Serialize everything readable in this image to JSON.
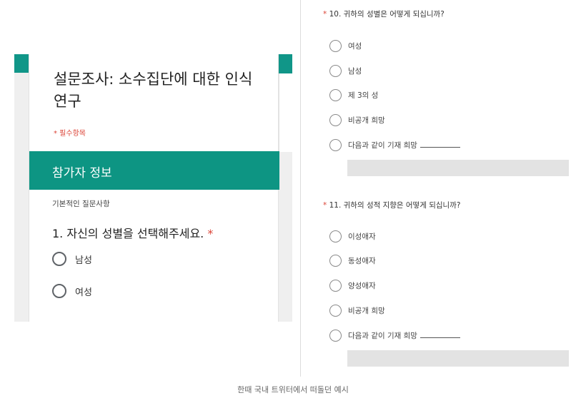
{
  "left_form": {
    "title": "설문조사: 소수집단에 대한 인식 연구",
    "required_note": "* 필수항목",
    "section_title": "참가자 정보",
    "section_description": "기본적인 질문사항",
    "question_text": "1. 자신의 성별을 선택해주세요.",
    "question_required_mark": "*",
    "options": [
      "남성",
      "여성"
    ],
    "accent_color": "#0d9583"
  },
  "right_form": {
    "q10": {
      "required_mark": "*",
      "title": "10. 귀하의 성별은 어떻게 되십니까?",
      "options": [
        "여성",
        "남성",
        "제 3의 성",
        "비공개 희망",
        "다음과 같이 기재 희망"
      ]
    },
    "q11": {
      "required_mark": "*",
      "title": "11. 귀하의 성적 지향은 어떻게 되십니까?",
      "options": [
        "이성애자",
        "동성애자",
        "양성애자",
        "비공개 희망",
        "다음과 같이 기재 희망"
      ]
    }
  },
  "caption": "한때 국내 트위터에서 떠돌던 예시"
}
